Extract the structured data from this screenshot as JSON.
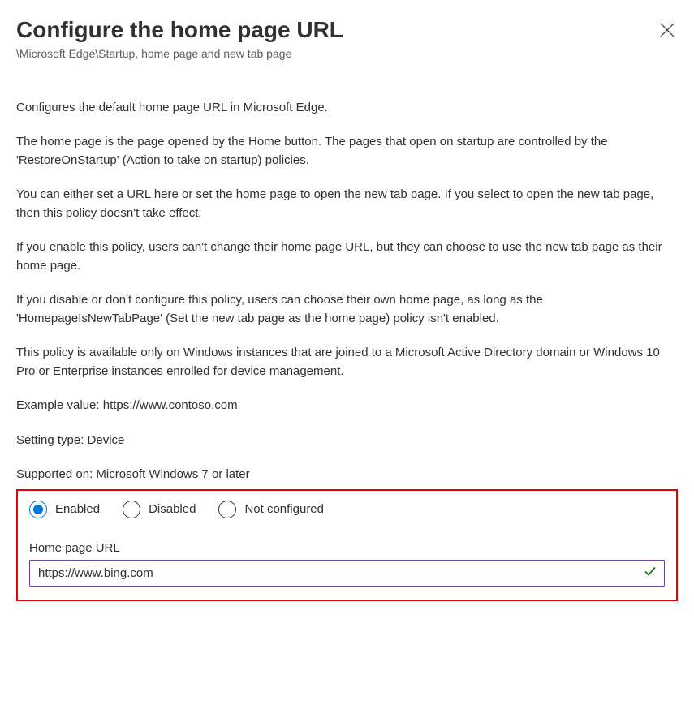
{
  "header": {
    "title": "Configure the home page URL",
    "breadcrumb": "\\Microsoft Edge\\Startup, home page and new tab page"
  },
  "description": {
    "p1": "Configures the default home page URL in Microsoft Edge.",
    "p2": "The home page is the page opened by the Home button. The pages that open on startup are controlled by the 'RestoreOnStartup' (Action to take on startup) policies.",
    "p3": "You can either set a URL here or set the home page to open the new tab page. If you select to open the new tab page, then this policy doesn't take effect.",
    "p4": "If you enable this policy, users can't change their home page URL, but they can choose to use the new tab page as their home page.",
    "p5": "If you disable or don't configure this policy, users can choose their own home page, as long as the 'HomepageIsNewTabPage' (Set the new tab page as the home page) policy isn't enabled.",
    "p6": "This policy is available only on Windows instances that are joined to a Microsoft Active Directory domain or Windows 10 Pro or Enterprise instances enrolled for device management.",
    "example": "Example value: https://www.contoso.com",
    "setting_type": "Setting type: Device",
    "supported_on": "Supported on: Microsoft Windows 7 or later"
  },
  "settings": {
    "radio": {
      "enabled": "Enabled",
      "disabled": "Disabled",
      "not_configured": "Not configured",
      "selected": "enabled"
    },
    "url_field": {
      "label": "Home page URL",
      "value": "https://www.bing.com"
    }
  }
}
